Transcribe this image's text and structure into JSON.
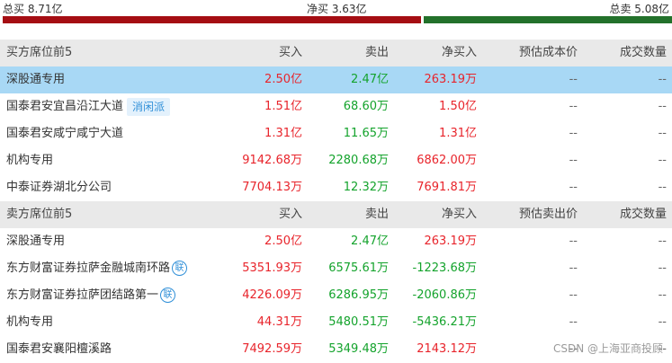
{
  "summary": {
    "total_buy": "总买 8.71亿",
    "net_buy": "净买 3.63亿",
    "total_sell": "总卖 5.08亿",
    "colors": {
      "buy_bar": "#a50d13",
      "sell_bar": "#23712b"
    }
  },
  "buy_table": {
    "headers": {
      "name": "买方席位前5",
      "buy": "买入",
      "sell": "卖出",
      "net": "净买入",
      "cost": "预估成本价",
      "qty": "成交数量"
    },
    "rows": [
      {
        "name": "深股通专用",
        "buy": "2.50亿",
        "sell": "2.47亿",
        "net": "263.19万",
        "cost": "--",
        "qty": "--"
      },
      {
        "name": "国泰君安宜昌沿江大道",
        "tag": "消闲派",
        "buy": "1.51亿",
        "sell": "68.60万",
        "net": "1.50亿",
        "cost": "--",
        "qty": "--"
      },
      {
        "name": "国泰君安咸宁咸宁大道",
        "buy": "1.31亿",
        "sell": "11.65万",
        "net": "1.31亿",
        "cost": "--",
        "qty": "--"
      },
      {
        "name": "机构专用",
        "buy": "9142.68万",
        "sell": "2280.68万",
        "net": "6862.00万",
        "cost": "--",
        "qty": "--"
      },
      {
        "name": "中泰证券湖北分公司",
        "buy": "7704.13万",
        "sell": "12.32万",
        "net": "7691.81万",
        "cost": "--",
        "qty": "--"
      }
    ]
  },
  "sell_table": {
    "headers": {
      "name": "卖方席位前5",
      "buy": "买入",
      "sell": "卖出",
      "net": "净买入",
      "cost": "预估卖出价",
      "qty": "成交数量"
    },
    "rows": [
      {
        "name": "深股通专用",
        "buy": "2.50亿",
        "sell": "2.47亿",
        "net": "263.19万",
        "cost": "--",
        "qty": "--"
      },
      {
        "name": "东方财富证券拉萨金融城南环路",
        "badge": "联",
        "buy": "5351.93万",
        "sell": "6575.61万",
        "net": "-1223.68万",
        "cost": "--",
        "qty": "--"
      },
      {
        "name": "东方财富证券拉萨团结路第一",
        "badge": "联",
        "buy": "4226.09万",
        "sell": "6286.95万",
        "net": "-2060.86万",
        "cost": "--",
        "qty": "--"
      },
      {
        "name": "机构专用",
        "buy": "44.31万",
        "sell": "5480.51万",
        "net": "-5436.21万",
        "cost": "--",
        "qty": "--"
      },
      {
        "name": "国泰君安襄阳檀溪路",
        "buy": "7492.59万",
        "sell": "5349.48万",
        "net": "2143.12万",
        "cost": "--",
        "qty": "--"
      }
    ]
  },
  "watermark": "CSDN @上海亚商投顾"
}
